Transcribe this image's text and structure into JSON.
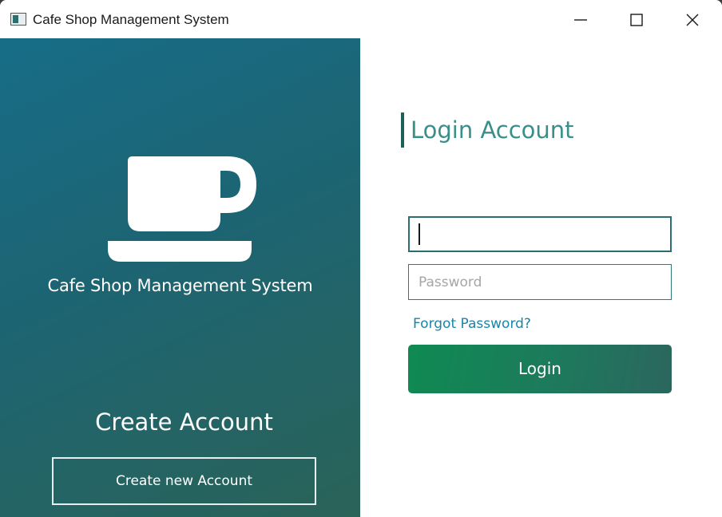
{
  "window": {
    "title": "Cafe Shop Management System",
    "controls": [
      "minimize",
      "maximize",
      "close"
    ]
  },
  "left_panel": {
    "icon": "coffee-cup-icon",
    "brand_text": "Cafe Shop Management System",
    "create_heading": "Create Account",
    "create_button_label": "Create new Account",
    "gradient_colors": [
      "#176d87",
      "#2a6358"
    ]
  },
  "login": {
    "heading": "Login Account",
    "username_value": "",
    "password_placeholder": "Password",
    "forgot_label": "Forgot Password?",
    "login_button_label": "Login",
    "accent_color": "#3a8f8b",
    "button_colors": [
      "#0f8a52",
      "#2b665e"
    ],
    "link_color": "#1a85a8"
  }
}
